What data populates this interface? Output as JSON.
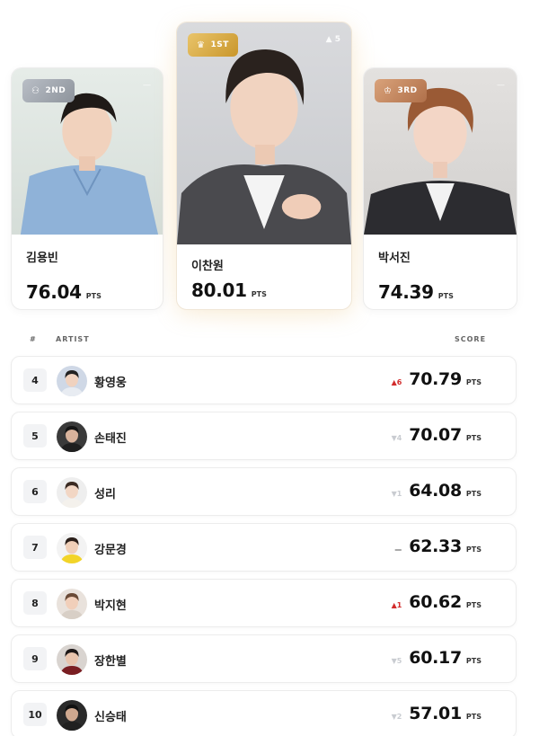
{
  "podium": [
    {
      "rank_label": "2ND",
      "name": "김용빈",
      "score": "76.04",
      "pts": "PTS",
      "more": "—"
    },
    {
      "rank_label": "1ST",
      "name": "이찬원",
      "score": "80.01",
      "pts": "PTS",
      "change": "▲ 5"
    },
    {
      "rank_label": "3RD",
      "name": "박서진",
      "score": "74.39",
      "pts": "PTS",
      "more": "—"
    }
  ],
  "table_header": {
    "rank": "#",
    "artist": "ARTIST",
    "score": "SCORE"
  },
  "rows": [
    {
      "rank": "4",
      "name": "황영웅",
      "delta": "▲6",
      "delta_dir": "up",
      "score": "70.79",
      "pts": "PTS"
    },
    {
      "rank": "5",
      "name": "손태진",
      "delta": "▼4",
      "delta_dir": "down",
      "score": "70.07",
      "pts": "PTS"
    },
    {
      "rank": "6",
      "name": "성리",
      "delta": "▼1",
      "delta_dir": "down",
      "score": "64.08",
      "pts": "PTS"
    },
    {
      "rank": "7",
      "name": "강문경",
      "delta": "—",
      "delta_dir": "same",
      "score": "62.33",
      "pts": "PTS"
    },
    {
      "rank": "8",
      "name": "박지현",
      "delta": "▲1",
      "delta_dir": "up",
      "score": "60.62",
      "pts": "PTS"
    },
    {
      "rank": "9",
      "name": "장한별",
      "delta": "▼5",
      "delta_dir": "down",
      "score": "60.17",
      "pts": "PTS"
    },
    {
      "rank": "10",
      "name": "신승태",
      "delta": "▼2",
      "delta_dir": "down",
      "score": "57.01",
      "pts": "PTS"
    }
  ],
  "icons": {
    "second": "medal-icon",
    "first": "crown-icon",
    "third": "trophy-icon"
  }
}
